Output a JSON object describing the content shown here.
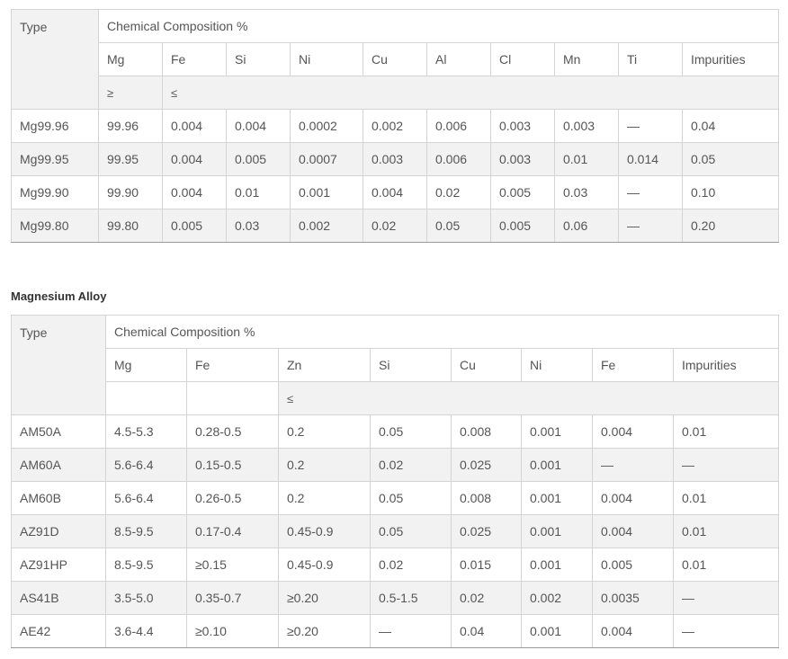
{
  "table1": {
    "type_label": "Type",
    "group_label": "Chemical Composition %",
    "columns": [
      "Mg",
      "Fe",
      "Si",
      "Ni",
      "Cu",
      "Al",
      "Cl",
      "Mn",
      "Ti",
      "Impurities"
    ],
    "sym_ge": "≥",
    "sym_le": "≤",
    "rows": [
      [
        "Mg99.96",
        "99.96",
        "0.004",
        "0.004",
        "0.0002",
        "0.002",
        "0.006",
        "0.003",
        "0.003",
        "—",
        "0.04"
      ],
      [
        "Mg99.95",
        "99.95",
        "0.004",
        "0.005",
        "0.0007",
        "0.003",
        "0.006",
        "0.003",
        "0.01",
        "0.014",
        "0.05"
      ],
      [
        "Mg99.90",
        "99.90",
        "0.004",
        "0.01",
        "0.001",
        "0.004",
        "0.02",
        "0.005",
        "0.03",
        "—",
        "0.10"
      ],
      [
        "Mg99.80",
        "99.80",
        "0.005",
        "0.03",
        "0.002",
        "0.02",
        "0.05",
        "0.005",
        "0.06",
        "—",
        "0.20"
      ]
    ]
  },
  "table2": {
    "caption": "Magnesium Alloy",
    "type_label": "Type",
    "group_label": "Chemical Composition %",
    "columns": [
      "Mg",
      "Fe",
      "Zn",
      "Si",
      "Cu",
      "Ni",
      "Fe",
      "Impurities"
    ],
    "sym_le": "≤",
    "rows": [
      [
        "AM50A",
        "4.5-5.3",
        "0.28-0.5",
        "0.2",
        "0.05",
        "0.008",
        "0.001",
        "0.004",
        "0.01"
      ],
      [
        "AM60A",
        "5.6-6.4",
        "0.15-0.5",
        "0.2",
        "0.02",
        "0.025",
        "0.001",
        "—",
        "—"
      ],
      [
        "AM60B",
        "5.6-6.4",
        "0.26-0.5",
        "0.2",
        "0.05",
        "0.008",
        "0.001",
        "0.004",
        "0.01"
      ],
      [
        "AZ91D",
        "8.5-9.5",
        "0.17-0.4",
        "0.45-0.9",
        "0.05",
        "0.025",
        "0.001",
        "0.004",
        "0.01"
      ],
      [
        "AZ91HP",
        "8.5-9.5",
        "≥0.15",
        "0.45-0.9",
        "0.02",
        "0.015",
        "0.001",
        "0.005",
        "0.01"
      ],
      [
        "AS41B",
        "3.5-5.0",
        "0.35-0.7",
        "≥0.20",
        "0.5-1.5",
        "0.02",
        "0.002",
        "0.0035",
        "—"
      ],
      [
        "AE42",
        "3.6-4.4",
        "≥0.10",
        "≥0.20",
        "—",
        "0.04",
        "0.001",
        "0.004",
        "—"
      ]
    ]
  }
}
